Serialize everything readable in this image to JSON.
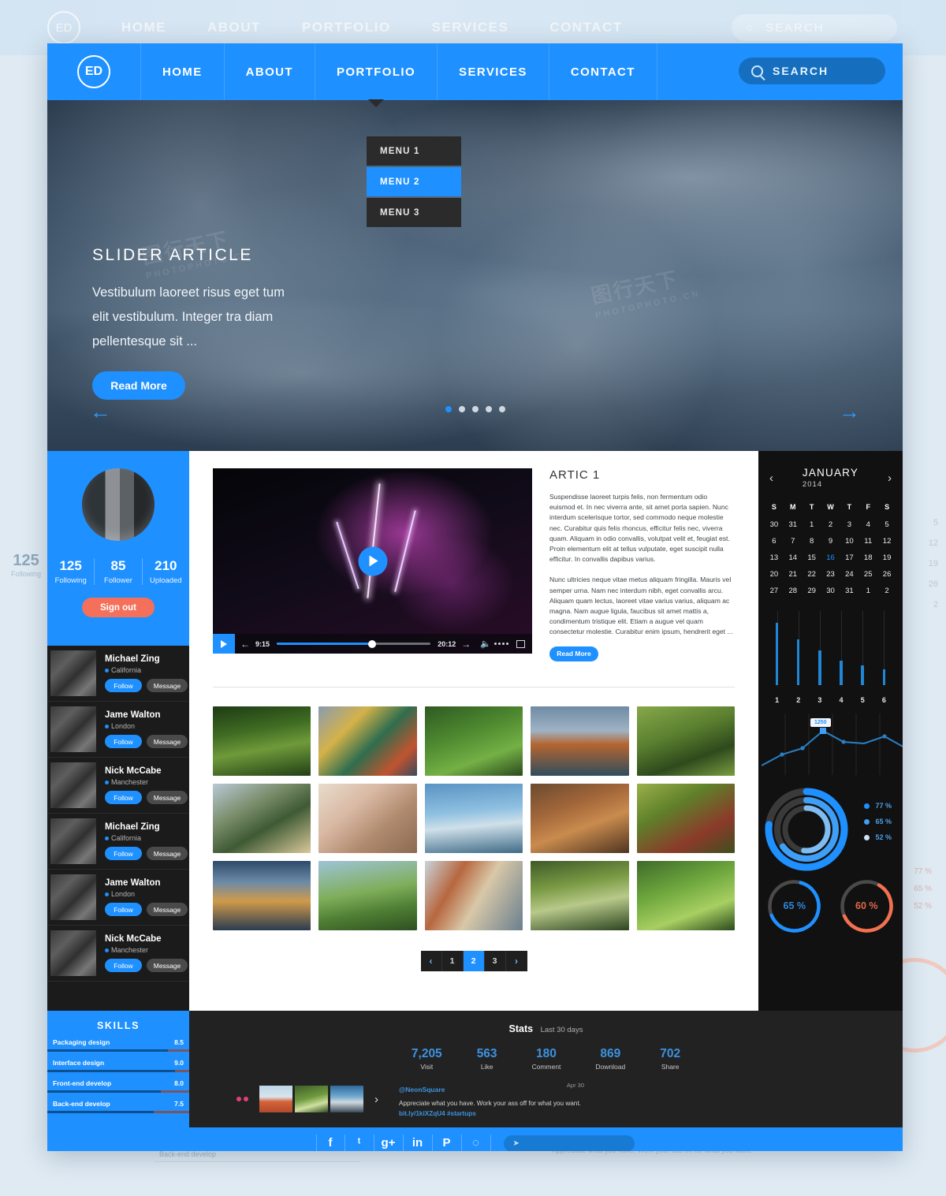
{
  "nav": {
    "logo": "ED",
    "links": [
      "HOME",
      "ABOUT",
      "PORTFOLIO",
      "SERVICES",
      "CONTACT"
    ],
    "active": "PORTFOLIO",
    "search_label": "SEARCH"
  },
  "dropdown": {
    "items": [
      "MENU 1",
      "MENU 2",
      "MENU 3"
    ],
    "active": "MENU 2"
  },
  "hero": {
    "title": "SLIDER ARTICLE",
    "text": "Vestibulum laoreet risus eget tum elit vestibulum. Integer tra diam pellentesque sit ...",
    "button": "Read More",
    "dots": 5,
    "active_dot": 1,
    "prev": "←",
    "next": "→"
  },
  "profile": {
    "stats": [
      {
        "num": "125",
        "label": "Following"
      },
      {
        "num": "85",
        "label": "Follower"
      },
      {
        "num": "210",
        "label": "Uploaded"
      }
    ],
    "signout": "Sign out"
  },
  "followers": [
    {
      "name": "Michael Zing",
      "location": "California",
      "status": "online",
      "follow": "Follow",
      "message": "Message"
    },
    {
      "name": "Jame Walton",
      "location": "London",
      "status": "online",
      "follow": "Follow",
      "message": "Message"
    },
    {
      "name": "Nick McCabe",
      "location": "Manchester",
      "status": "offline",
      "follow": "Follow",
      "message": "Message"
    },
    {
      "name": "Michael Zing",
      "location": "California",
      "status": "online",
      "follow": "Follow",
      "message": "Message"
    },
    {
      "name": "Jame Walton",
      "location": "London",
      "status": "online",
      "follow": "Follow",
      "message": "Message"
    },
    {
      "name": "Nick McCabe",
      "location": "Manchester",
      "status": "offline",
      "follow": "Follow",
      "message": "Message"
    }
  ],
  "video": {
    "current_time": "9:15",
    "total_time": "20:12"
  },
  "article": {
    "title": "ARTIC 1",
    "p1": "Suspendisse laoreet turpis felis, non fermentum odio euismod et. In nec viverra ante, sit amet porta sapien. Nunc interdum scelerisque tortor, sed commodo neque molestie nec. Curabitur quis felis rhoncus, efficitur felis nec, viverra quam. Aliquam in odio convallis, volutpat velit et, feugiat est. Proin elementum elit at tellus vulputate, eget suscipit nulla efficitur. In convallis dapibus varius.",
    "p2": "Nunc ultricies neque vitae metus aliquam fringilla. Mauris vel semper urna. Nam nec interdum nibh, eget convallis arcu. Aliquam quam lectus, laoreet vitae varius varius, aliquam ac magna. Nam augue ligula, faucibus sit amet mattis a, condimentum tristique elit. Etiam a augue vel quam consectetur molestie. Curabitur enim ipsum, hendrerit eget ...",
    "button": "Read More"
  },
  "pager": {
    "prev": "‹",
    "next": "›",
    "pages": [
      "1",
      "2",
      "3"
    ],
    "active": "2"
  },
  "calendar": {
    "month": "JANUARY",
    "year": "2014",
    "prev": "‹",
    "next": "›",
    "dow": [
      "S",
      "M",
      "T",
      "W",
      "T",
      "F",
      "S"
    ],
    "selected": 16,
    "weeks": [
      [
        "30",
        "31",
        "1",
        "2",
        "3",
        "4",
        "5"
      ],
      [
        "6",
        "7",
        "8",
        "9",
        "10",
        "11",
        "12"
      ],
      [
        "13",
        "14",
        "15",
        "16",
        "17",
        "18",
        "19"
      ],
      [
        "20",
        "21",
        "22",
        "23",
        "24",
        "25",
        "26"
      ],
      [
        "27",
        "28",
        "29",
        "30",
        "31",
        "1",
        "2"
      ]
    ]
  },
  "chart_data": [
    {
      "type": "bar",
      "title": "",
      "categories": [
        "1",
        "2",
        "3",
        "4",
        "5",
        "6"
      ],
      "values": [
        100,
        72,
        55,
        38,
        30,
        24
      ],
      "ylim": [
        0,
        100
      ],
      "xlabel": "",
      "ylabel": "",
      "grid": true,
      "color": "#1f87d6"
    },
    {
      "type": "line",
      "title": "",
      "x": [
        0,
        1,
        2,
        3,
        4,
        5,
        6,
        7
      ],
      "values": [
        8,
        30,
        44,
        76,
        52,
        48,
        62,
        40
      ],
      "tooltip_label": "1250",
      "tooltip_index": 3,
      "grid": true,
      "color": "#2a7fc4"
    },
    {
      "type": "pie",
      "title": "",
      "legend": [
        "77 %",
        "65 %",
        "52 %"
      ],
      "values": [
        77,
        65,
        52
      ],
      "colors": [
        "#1e90ff",
        "#3f9ef5",
        "#9fcbf5"
      ],
      "legend_position": "right"
    },
    {
      "type": "pie",
      "title": "",
      "legend": [
        "65 %"
      ],
      "values": [
        65
      ],
      "colors": [
        "#1e90ff"
      ]
    },
    {
      "type": "pie",
      "title": "",
      "legend": [
        "60 %"
      ],
      "values": [
        60
      ],
      "colors": [
        "#f4704f"
      ]
    },
    {
      "type": "bar",
      "title": "SKILLS",
      "categories": [
        "Packaging design",
        "Interface design",
        "Front-end develop",
        "Back-end develop"
      ],
      "values": [
        8.5,
        9.0,
        8.0,
        7.5
      ],
      "ylim": [
        0,
        10
      ],
      "color": "#0d4f8f"
    }
  ],
  "skills": {
    "title": "SKILLS",
    "items": [
      {
        "label": "Packaging design",
        "value": "8.5",
        "pct": 85
      },
      {
        "label": "Interface design",
        "value": "9.0",
        "pct": 90
      },
      {
        "label": "Front-end develop",
        "value": "8.0",
        "pct": 80
      },
      {
        "label": "Back-end develop",
        "value": "7.5",
        "pct": 75
      }
    ]
  },
  "stats": {
    "title": "Stats",
    "subtitle": "Last 30 days",
    "items": [
      {
        "value": "7,205",
        "label": "Visit"
      },
      {
        "value": "563",
        "label": "Like"
      },
      {
        "value": "180",
        "label": "Comment"
      },
      {
        "value": "869",
        "label": "Download"
      },
      {
        "value": "702",
        "label": "Share"
      }
    ]
  },
  "tweet": {
    "handle": "@NeonSquare",
    "date": "Apr 30",
    "text": "Appreciate what you have. Work your ass off for what you want.",
    "link": "bit.ly/1kiXZqU4 #startups",
    "next": "›"
  },
  "footer": {
    "socials": [
      "f",
      "ᵗ",
      "g+",
      "in",
      "P",
      "◌"
    ],
    "social_names": [
      "facebook",
      "twitter",
      "googleplus",
      "linkedin",
      "pinterest",
      "dribbble"
    ],
    "input_placeholder": ""
  },
  "watermark": {
    "text": "图行天下",
    "sub": "PHOTOPHOTO.CN"
  }
}
